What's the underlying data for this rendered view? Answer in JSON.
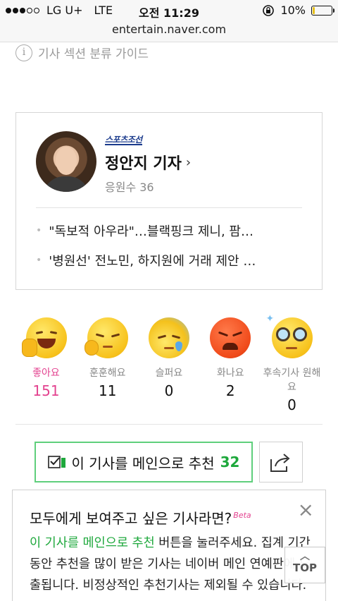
{
  "status_bar": {
    "carrier": "LG U+",
    "network": "LTE",
    "time": "오전 11:29",
    "battery_percent": "10%",
    "battery_level": 0.1
  },
  "url_bar": {
    "url": "entertain.naver.com"
  },
  "guide": {
    "label": "기사 섹션 분류 가이드"
  },
  "reporter": {
    "press": "스포츠조선",
    "name": "정안지 기자",
    "support_label": "응원수 36",
    "articles": [
      "\"독보적 아우라\"…블랙핑크 제니, 팜…",
      "'병원선' 전노민, 하지원에 거래 제안 …"
    ]
  },
  "reactions": [
    {
      "label": "좋아요",
      "count": "151",
      "icon": "thumbs-up-smile-emoji"
    },
    {
      "label": "훈훈해요",
      "count": "11",
      "icon": "warm-smile-emoji"
    },
    {
      "label": "슬퍼요",
      "count": "0",
      "icon": "sad-emoji"
    },
    {
      "label": "화나요",
      "count": "2",
      "icon": "angry-emoji"
    },
    {
      "label": "후속기사 원해요",
      "count": "0",
      "icon": "glasses-emoji"
    }
  ],
  "recommend": {
    "label": "이 기사를 메인으로 추천",
    "count": "32"
  },
  "info": {
    "title": "모두에게 보여주고 싶은 기사라면?",
    "beta": "Beta",
    "body_highlight": "이 기사를 메인으로 추천",
    "body_rest": " 버튼을 눌러주세요. 집계 기간 동안 추천을 많이 받은 기사는 네이버 메인 연예판에 노출됩니다. 비정상적인 추천기사는 제외될 수 있습니다."
  },
  "top_button": {
    "label": "TOP"
  },
  "colors": {
    "accent_green": "#1ea83c",
    "like_pink": "#e3428f"
  }
}
